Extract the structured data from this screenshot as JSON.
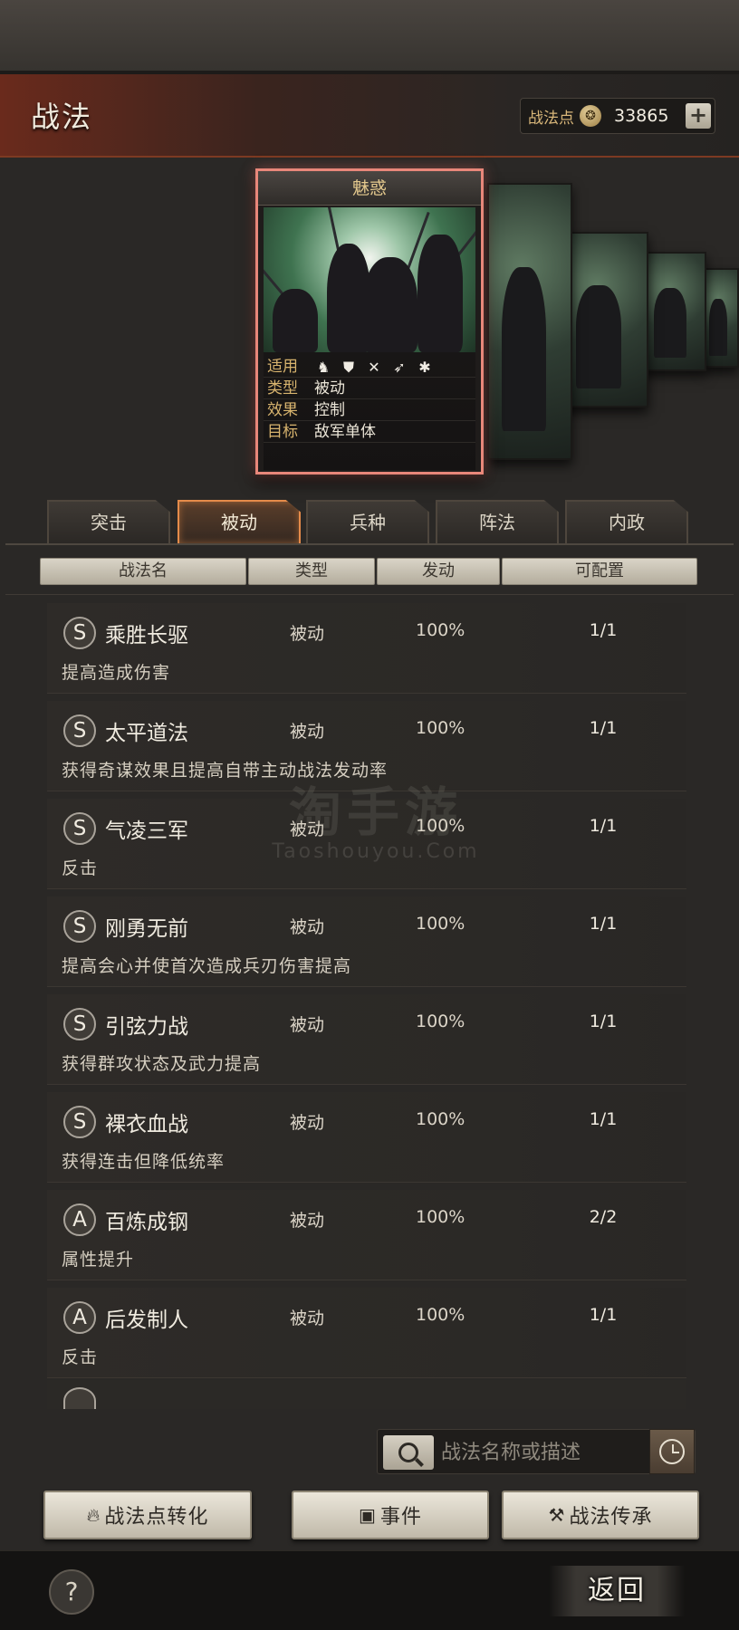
{
  "header": {
    "title": "战法",
    "points_label": "战法点",
    "points_value": "33865",
    "add_label": "+"
  },
  "card": {
    "name": "魅惑",
    "rows": [
      {
        "key": "适用",
        "value": ""
      },
      {
        "key": "类型",
        "value": "被动"
      },
      {
        "key": "效果",
        "value": "控制"
      },
      {
        "key": "目标",
        "value": "敌军单体"
      }
    ],
    "apply_icons": [
      "cavalry-icon",
      "shield-icon",
      "archer-icon",
      "spear-icon",
      "siege-icon"
    ]
  },
  "tabs": [
    {
      "label": "突击",
      "active": false
    },
    {
      "label": "被动",
      "active": true
    },
    {
      "label": "兵种",
      "active": false
    },
    {
      "label": "阵法",
      "active": false
    },
    {
      "label": "内政",
      "active": false
    }
  ],
  "columns": {
    "name": "战法名",
    "type": "类型",
    "rate": "发动",
    "config": "可配置"
  },
  "skills": [
    {
      "grade": "S",
      "name": "乘胜长驱",
      "type": "被动",
      "rate": "100%",
      "config": "1/1",
      "desc": "提高造成伤害"
    },
    {
      "grade": "S",
      "name": "太平道法",
      "type": "被动",
      "rate": "100%",
      "config": "1/1",
      "desc": "获得奇谋效果且提高自带主动战法发动率"
    },
    {
      "grade": "S",
      "name": "气凌三军",
      "type": "被动",
      "rate": "100%",
      "config": "1/1",
      "desc": "反击"
    },
    {
      "grade": "S",
      "name": "刚勇无前",
      "type": "被动",
      "rate": "100%",
      "config": "1/1",
      "desc": "提高会心并使首次造成兵刃伤害提高"
    },
    {
      "grade": "S",
      "name": "引弦力战",
      "type": "被动",
      "rate": "100%",
      "config": "1/1",
      "desc": "获得群攻状态及武力提高"
    },
    {
      "grade": "S",
      "name": "裸衣血战",
      "type": "被动",
      "rate": "100%",
      "config": "1/1",
      "desc": "获得连击但降低统率"
    },
    {
      "grade": "A",
      "name": "百炼成钢",
      "type": "被动",
      "rate": "100%",
      "config": "2/2",
      "desc": "属性提升"
    },
    {
      "grade": "A",
      "name": "后发制人",
      "type": "被动",
      "rate": "100%",
      "config": "1/1",
      "desc": "反击"
    }
  ],
  "watermark": {
    "line1": "淘手游",
    "line2": "Taoshouyou.Com"
  },
  "search": {
    "placeholder": "战法名称或描述"
  },
  "buttons": {
    "convert": "战法点转化",
    "event": "事件",
    "inherit": "战法传承"
  },
  "footer": {
    "help": "?",
    "back": "返回"
  },
  "colors": {
    "accent": "#e58b4a",
    "card_border": "#e8877a",
    "header_red": "#6a2a1c"
  }
}
